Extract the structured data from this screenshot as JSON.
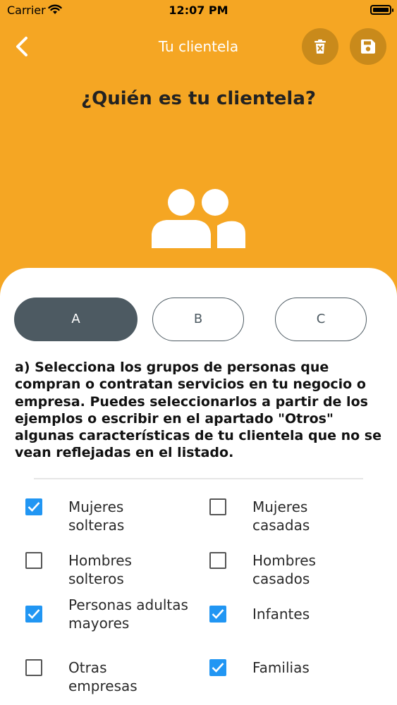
{
  "status_bar": {
    "carrier": "Carrier",
    "time": "12:07 PM"
  },
  "nav": {
    "title": "Tu clientela",
    "back_icon": "chevron-left-icon",
    "delete_icon": "trash-icon",
    "save_icon": "save-icon"
  },
  "header": {
    "heading": "¿Quién es tu clientela?",
    "illustration": "people-icon"
  },
  "tabs": [
    {
      "label": "A",
      "selected": true
    },
    {
      "label": "B",
      "selected": false
    },
    {
      "label": "C",
      "selected": false
    }
  ],
  "question": "a) Selecciona los grupos de personas que compran o contratan servicios en tu negocio o empresa. Puedes seleccionarlos a partir de los ejemplos o escribir en el apartado \"Otros\" algunas características de tu clientela que no se vean reflejadas en el listado.",
  "options": [
    {
      "label": "Mujeres solteras",
      "checked": true
    },
    {
      "label": "Mujeres casadas",
      "checked": false
    },
    {
      "label": "Hombres solteros",
      "checked": false
    },
    {
      "label": "Hombres casados",
      "checked": false
    },
    {
      "label": "Personas adultas mayores",
      "checked": true
    },
    {
      "label": "Infantes",
      "checked": true
    },
    {
      "label": "Otras empresas",
      "checked": false
    },
    {
      "label": "Familias",
      "checked": true
    }
  ],
  "colors": {
    "accent": "#F5A623",
    "button_dark": "#C98A1B",
    "tab_selected": "#4D5A62",
    "checkbox": "#2196F3"
  }
}
